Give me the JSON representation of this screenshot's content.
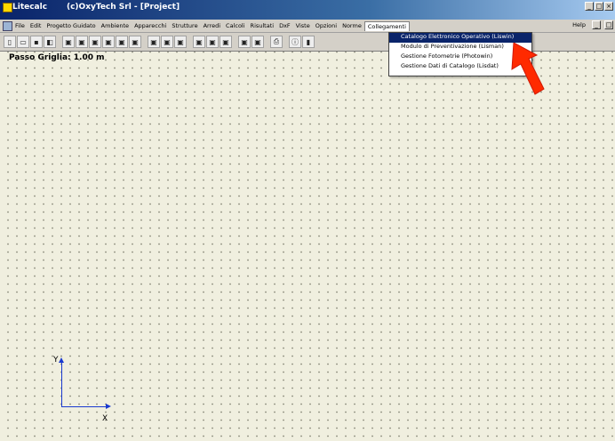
{
  "window": {
    "title": "Litecalc       (c)OxyTech Srl - [Project]"
  },
  "menubar": {
    "items": [
      "File",
      "Edit",
      "Progetto Guidato",
      "Ambiente",
      "Apparecchi",
      "Strutture",
      "Arredi",
      "Calcoli",
      "Risultati",
      "DxF",
      "Viste",
      "Opzioni",
      "Norme",
      "Collegamenti"
    ],
    "active_index": 13,
    "help_label": "Help"
  },
  "toolbar": {
    "buttons": [
      "new-file-icon",
      "open-folder-icon",
      "save-disk-icon",
      "project-icon",
      "luminaire-icon-1",
      "luminaire-icon-2",
      "luminaire-icon-3",
      "luminaire-icon-4",
      "luminaire-icon-5",
      "luminaire-icon-6",
      "calc-icon-1",
      "calc-icon-2",
      "calc-icon-3",
      "result-icon-1",
      "result-icon-2",
      "result-icon-3",
      "view-3d-icon",
      "view-render-icon",
      "print-icon",
      "info-icon",
      "norm-icon"
    ]
  },
  "canvas": {
    "grid_step_label": "Passo Griglia: 1.00 m",
    "axis_y_label": "Y",
    "axis_x_label": "X"
  },
  "dropdown": {
    "menu": "Collegamenti",
    "items": [
      "Catalogo Elettronico Operativo (Liswin)",
      "Modulo di Preventivazione (Lisman)",
      "Gestione Fotometrie (Photowin)",
      "Gestione Dati di Catalogo (Lisdat)"
    ],
    "selected_index": 0
  },
  "colors": {
    "canvas_bg": "#f0efdf",
    "selection": "#0a246a",
    "axis": "#1a3ad0",
    "annotation_arrow": "#ff2a00"
  }
}
